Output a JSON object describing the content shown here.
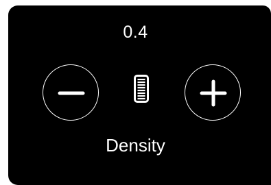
{
  "density": {
    "value": "0.4",
    "label": "Density",
    "decrease_icon": "minus-circle-icon",
    "increase_icon": "plus-circle-icon",
    "indicator_icon": "density-lines-icon"
  },
  "colors": {
    "panel_background": "#000000",
    "foreground": "#ffffff"
  }
}
